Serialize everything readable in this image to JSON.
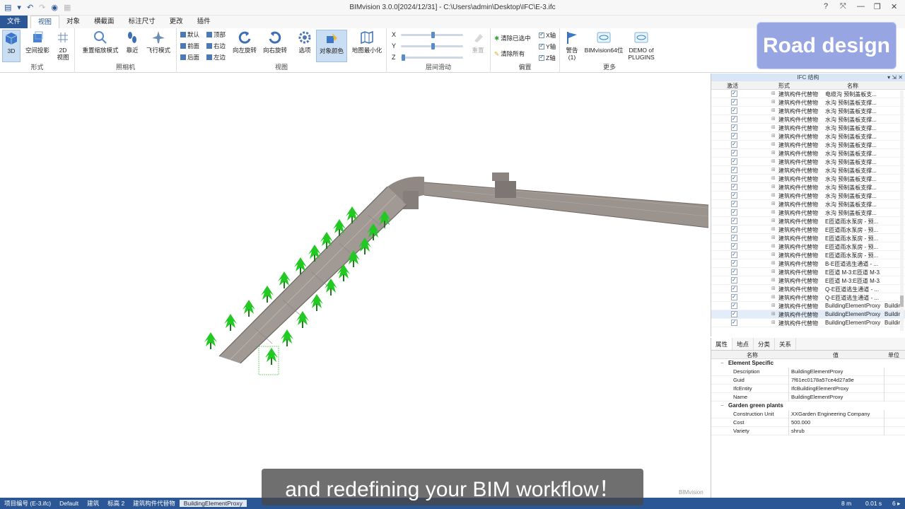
{
  "window": {
    "title": "BIMvision 3.0.0[2024/12/31] - C:\\Users\\admin\\Desktop\\IFC\\E-3.ifc",
    "controls": [
      "?",
      "⤧",
      "—",
      "❐",
      "✕"
    ]
  },
  "ribbon_tabs": [
    {
      "label": "文件",
      "kind": "file"
    },
    {
      "label": "视图",
      "kind": "active"
    },
    {
      "label": "对象",
      "kind": ""
    },
    {
      "label": "横截面",
      "kind": ""
    },
    {
      "label": "标注尺寸",
      "kind": ""
    },
    {
      "label": "更改",
      "kind": ""
    },
    {
      "label": "插件",
      "kind": ""
    }
  ],
  "ribbon": {
    "groups": {
      "form": "形式",
      "camera": "照相机",
      "view": "视图",
      "floor": "层间滑动",
      "offset": "偏置",
      "more": "更多"
    },
    "form": {
      "b3d": "3D",
      "projection": "空间投影",
      "b2d_line1": "2D",
      "b2d_line2": "视图"
    },
    "camera": {
      "reset": "重置缩放模式",
      "near": "靠近",
      "fly": "飞行模式"
    },
    "view": {
      "default": "默认",
      "top": "顶部",
      "front": "前面",
      "right": "右边",
      "back": "后面",
      "left": "左边",
      "rotate_left": "向左旋转",
      "rotate_right": "向右旋转",
      "options": "选项",
      "object_color": "对象颜色",
      "minimize": "地图最小化"
    },
    "floor": {
      "x": "X",
      "y": "Y",
      "z": "Z",
      "reset": "重置"
    },
    "offset": {
      "clear_selected": "清除已选中",
      "clear_all": "清除所有",
      "x_axis": "X轴",
      "y_axis": "Y轴",
      "z_axis": "Z轴"
    },
    "more": {
      "warning_line1": "警告",
      "warning_line2": "(1)",
      "bim64": "BIMvision64位",
      "demo_line1": "DEMO of",
      "demo_line2": "PLUGINS"
    }
  },
  "badge": "Road design",
  "ifc_panel": {
    "title": "IFC 结构",
    "buttons": "▾ ⇲ ✕",
    "col_active": "激活",
    "col_form": "形式",
    "col_name": "名称",
    "rows": [
      {
        "form": "建筑构件代替物",
        "name": "电缆沟 预制盖板支...",
        "extra": ""
      },
      {
        "form": "建筑构件代替物",
        "name": "水沟 预制盖板支撑...",
        "extra": ""
      },
      {
        "form": "建筑构件代替物",
        "name": "水沟 预制盖板支撑...",
        "extra": ""
      },
      {
        "form": "建筑构件代替物",
        "name": "水沟 预制盖板支撑...",
        "extra": ""
      },
      {
        "form": "建筑构件代替物",
        "name": "水沟 预制盖板支撑...",
        "extra": ""
      },
      {
        "form": "建筑构件代替物",
        "name": "水沟 预制盖板支撑...",
        "extra": ""
      },
      {
        "form": "建筑构件代替物",
        "name": "水沟 预制盖板支撑...",
        "extra": ""
      },
      {
        "form": "建筑构件代替物",
        "name": "水沟 预制盖板支撑...",
        "extra": ""
      },
      {
        "form": "建筑构件代替物",
        "name": "水沟 预制盖板支撑...",
        "extra": ""
      },
      {
        "form": "建筑构件代替物",
        "name": "水沟 预制盖板支撑...",
        "extra": ""
      },
      {
        "form": "建筑构件代替物",
        "name": "水沟 预制盖板支撑...",
        "extra": ""
      },
      {
        "form": "建筑构件代替物",
        "name": "水沟 预制盖板支撑...",
        "extra": ""
      },
      {
        "form": "建筑构件代替物",
        "name": "水沟 预制盖板支撑...",
        "extra": ""
      },
      {
        "form": "建筑构件代替物",
        "name": "水沟 预制盖板支撑...",
        "extra": ""
      },
      {
        "form": "建筑构件代替物",
        "name": "水沟 预制盖板支撑...",
        "extra": ""
      },
      {
        "form": "建筑构件代替物",
        "name": "E匝道雨水泵房 - 预...",
        "extra": ""
      },
      {
        "form": "建筑构件代替物",
        "name": "E匝道雨水泵房 - 预...",
        "extra": ""
      },
      {
        "form": "建筑构件代替物",
        "name": "E匝道雨水泵房 - 预...",
        "extra": ""
      },
      {
        "form": "建筑构件代替物",
        "name": "E匝道雨水泵房 - 预...",
        "extra": ""
      },
      {
        "form": "建筑构件代替物",
        "name": "E匝道雨水泵房 - 预...",
        "extra": ""
      },
      {
        "form": "建筑构件代替物",
        "name": "B-E匝道逃生通道 - ...",
        "extra": ""
      },
      {
        "form": "建筑构件代替物",
        "name": "E匝道 M-3:E匝道 M-3...",
        "extra": ""
      },
      {
        "form": "建筑构件代替物",
        "name": "E匝道 M-3:E匝道 M-3...",
        "extra": ""
      },
      {
        "form": "建筑构件代替物",
        "name": "Q-E匝道逃生通道 - ...",
        "extra": ""
      },
      {
        "form": "建筑构件代替物",
        "name": "Q-E匝道逃生通道 - ...",
        "extra": ""
      },
      {
        "form": "建筑构件代替物",
        "name": "BuildingElementProxy",
        "extra": "Buildir"
      },
      {
        "form": "建筑构件代替物",
        "name": "BuildingElementProxy",
        "extra": "Buildir"
      },
      {
        "form": "建筑构件代替物",
        "name": "BuildingElementProxy",
        "extra": "Buildir"
      }
    ]
  },
  "props_panel": {
    "tabs": [
      "属性",
      "地点",
      "分类",
      "关系"
    ],
    "col_name": "名称",
    "col_value": "值",
    "col_unit": "单位",
    "sections": [
      {
        "title": "Element Specific",
        "rows": [
          {
            "k": "Description",
            "v": "BuildingElementProxy"
          },
          {
            "k": "Guid",
            "v": "7f61ec0178a57ce4d27a9e"
          },
          {
            "k": "IfcEntity",
            "v": "IfcBuildingElementProxy"
          },
          {
            "k": "Name",
            "v": "BuildingElementProxy"
          }
        ]
      },
      {
        "title": "Garden green plants",
        "rows": [
          {
            "k": "Construction Unit",
            "v": "XXGarden Engineering Company"
          },
          {
            "k": "Cost",
            "v": "500.000"
          },
          {
            "k": "Variety",
            "v": "shrub"
          }
        ]
      }
    ]
  },
  "watermark": "BIMvision",
  "subtitle": "and redefining your BIM workflow！",
  "statusbar": {
    "items": [
      "项目编号 (E-3.ifc)",
      "Default",
      "建筑",
      "标高 2",
      "建筑构件代替物",
      "BuildingElementProxy"
    ],
    "right": [
      "8 m",
      "0.01 s",
      "6 ▸"
    ]
  }
}
